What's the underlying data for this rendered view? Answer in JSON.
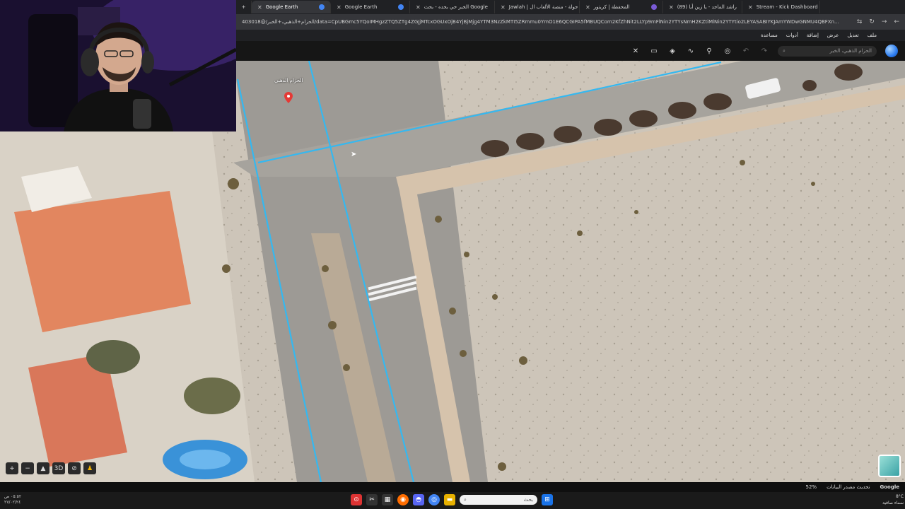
{
  "browser": {
    "tabs": [
      {
        "title": "Google Earth",
        "color": "#4285f4",
        "active": true
      },
      {
        "title": "Google Earth",
        "color": "#4285f4",
        "active": false
      },
      {
        "title": "الخبر حي بحده - بحث Google",
        "color": "#ffffff",
        "active": false
      },
      {
        "title": "Jawlah | جولة - منصة الألعاب ال",
        "color": "#d04b4b",
        "active": false
      },
      {
        "title": "المحفظة | كريتور",
        "color": "#7a5bd6",
        "active": false
      },
      {
        "title": "(89) راشد الماجد - يا زين أيا",
        "color": "#ff0000",
        "active": false
      },
      {
        "title": "Stream - Kick Dashboard",
        "color": "#53fc18",
        "active": false
      }
    ],
    "new_tab": "+",
    "url": "403018@/الحزام+الذهبي،+الخبر/data=CpUBGmc5YQoIMHgzZTQ5ZTg4ZGJjMTcxOGUxOjB4YjBjMjg4YTM3NzZkMTI5ZRmmu0YmO1E6QCGIPA5fMBUQCom2KfZhNit2LLYp9mFlNin2YTYsNmH2KZtiMlNin2YTYtio2LEYASABIYKJAmYWDwGNMU4QBFXn..."
  },
  "ge_menu": [
    "ملف",
    "تعديل",
    "عرض",
    "إضافة",
    "أدوات",
    "مساعدة"
  ],
  "ge_toolbar": {
    "search_placeholder": "الحزام الذهبي، الخبر"
  },
  "map": {
    "pin_label": "الحزام الذهبي",
    "controls": [
      "+",
      "−",
      "",
      "3D",
      "",
      ""
    ]
  },
  "status_bar": {
    "google": "Google",
    "data_update": "تحديث مصدر البيانات",
    "percent": "52%"
  },
  "taskbar": {
    "left_time": "٠٥:٥٢ ص",
    "left_date": "٢٧/٠٢/٢٤",
    "search_placeholder": "بحث",
    "weather_temp": "8°C",
    "weather_desc": "سماء صافية"
  }
}
